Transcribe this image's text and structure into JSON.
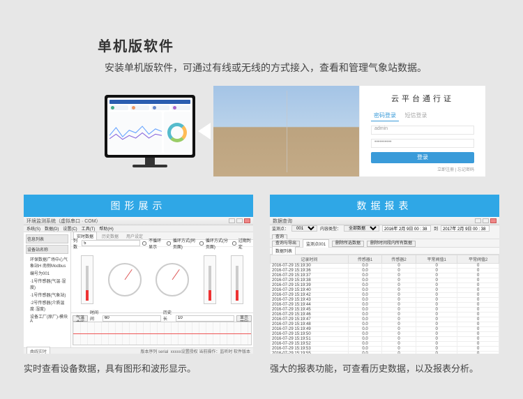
{
  "title": "单机版软件",
  "subtitle": "安装单机版软件，可通过有线或无线的方式接入，查看和管理气象站数据。",
  "login": {
    "title": "云平台通行证",
    "tab_active": "密码登录",
    "tab_inactive": "短信登录",
    "user_value": "admin",
    "pass_value": "••••••••••",
    "submit": "登录",
    "links": "立即注册 | 忘记密码"
  },
  "panel_left": {
    "header": "图形展示",
    "app_title": "环境监测系统（虚拟串口 · COM）",
    "menu": [
      "系统(S)",
      "数据(D)",
      "设置(C)",
      "工具(T)",
      "帮助(H)"
    ],
    "tree_title": "信息列表",
    "tree_header": "设备站名称",
    "tree_items": [
      "环保数据广场中心气象站H 南侧Modbus",
      "编号为001",
      "·1号传感器(气温·湿度)",
      "·1号传感器(气象站)",
      "·2号传感器(介质温度·湿度)",
      "设备工厂(原厂)-模块A"
    ],
    "tabs_active": "实时数据",
    "tabs": [
      "实时数据",
      "历史数据",
      "用户设定"
    ],
    "col_label": "列数",
    "col_value": "5",
    "opt_none": "不循环显示",
    "opt_cycle1": "循环方式(同页面)",
    "opt_cycle2": "循环方式(分页面)",
    "opt_over": "过期判定",
    "wave_label": "气温曲线",
    "wave_interval_l": "时间间隔：",
    "wave_interval_v": "60",
    "wave_len_l": "历史长度：",
    "wave_len_v": "10",
    "wave_refresh": "显示范围",
    "wave_tab1": "曲线实时",
    "status": "版本序列 serial_xxxxx设置授权   当前操作：监听时    软件版本",
    "caption": "实时查看设备数据，具有图形和波形显示。"
  },
  "panel_right": {
    "header": "数据报表",
    "app_title": "数据查询",
    "station_l": "监测点：",
    "station_v": "001",
    "type_l": "内容类型：",
    "type_v": "全部数据",
    "date_from": "2016年 2月 9日 00 : 38",
    "date_to_l": "到",
    "date_to": "2017年 2月 9日 00 : 38",
    "btn_query": "查询",
    "btn_export": "查询与导出",
    "btn_del": "删除所选数据",
    "btn_delrange": "删除时间段内所有数据",
    "tab_active": "监测点001",
    "tab2": "数据列表",
    "chart_data": {
      "type": "table",
      "columns": [
        "记录时间",
        "传感器1",
        "传感器2",
        "平常阀值1",
        "平常阀值2"
      ],
      "rows": [
        [
          "2016-07-29 15:19:30",
          "0.0",
          "0",
          "0",
          "0"
        ],
        [
          "2016-07-29 15:19:36",
          "0.0",
          "0",
          "0",
          "0"
        ],
        [
          "2016-07-29 15:19:37",
          "0.0",
          "0",
          "0",
          "0"
        ],
        [
          "2016-07-29 15:19:38",
          "0.0",
          "0",
          "0",
          "0"
        ],
        [
          "2016-07-29 15:19:39",
          "0.0",
          "0",
          "0",
          "0"
        ],
        [
          "2016-07-29 15:19:40",
          "0.0",
          "0",
          "0",
          "0"
        ],
        [
          "2016-07-29 15:19:42",
          "0.0",
          "0",
          "0",
          "0"
        ],
        [
          "2016-07-29 15:19:43",
          "0.0",
          "0",
          "0",
          "0"
        ],
        [
          "2016-07-29 15:19:44",
          "0.0",
          "0",
          "0",
          "0"
        ],
        [
          "2016-07-29 15:19:45",
          "0.0",
          "0",
          "0",
          "0"
        ],
        [
          "2016-07-29 15:19:46",
          "0.0",
          "0",
          "0",
          "0"
        ],
        [
          "2016-07-29 15:19:47",
          "0.0",
          "0",
          "0",
          "0"
        ],
        [
          "2016-07-29 15:19:48",
          "0.0",
          "0",
          "0",
          "0"
        ],
        [
          "2016-07-29 15:19:49",
          "0.0",
          "0",
          "0",
          "0"
        ],
        [
          "2016-07-29 15:19:50",
          "0.0",
          "0",
          "0",
          "0"
        ],
        [
          "2016-07-29 15:19:51",
          "0.0",
          "0",
          "0",
          "0"
        ],
        [
          "2016-07-29 15:19:52",
          "0.0",
          "0",
          "0",
          "0"
        ],
        [
          "2016-07-29 15:19:53",
          "0.0",
          "0",
          "0",
          "0"
        ],
        [
          "2016-07-29 15:19:55",
          "0.0",
          "0",
          "0",
          "0"
        ]
      ]
    },
    "caption": "强大的报表功能，可查看历史数据，以及报表分析。"
  }
}
